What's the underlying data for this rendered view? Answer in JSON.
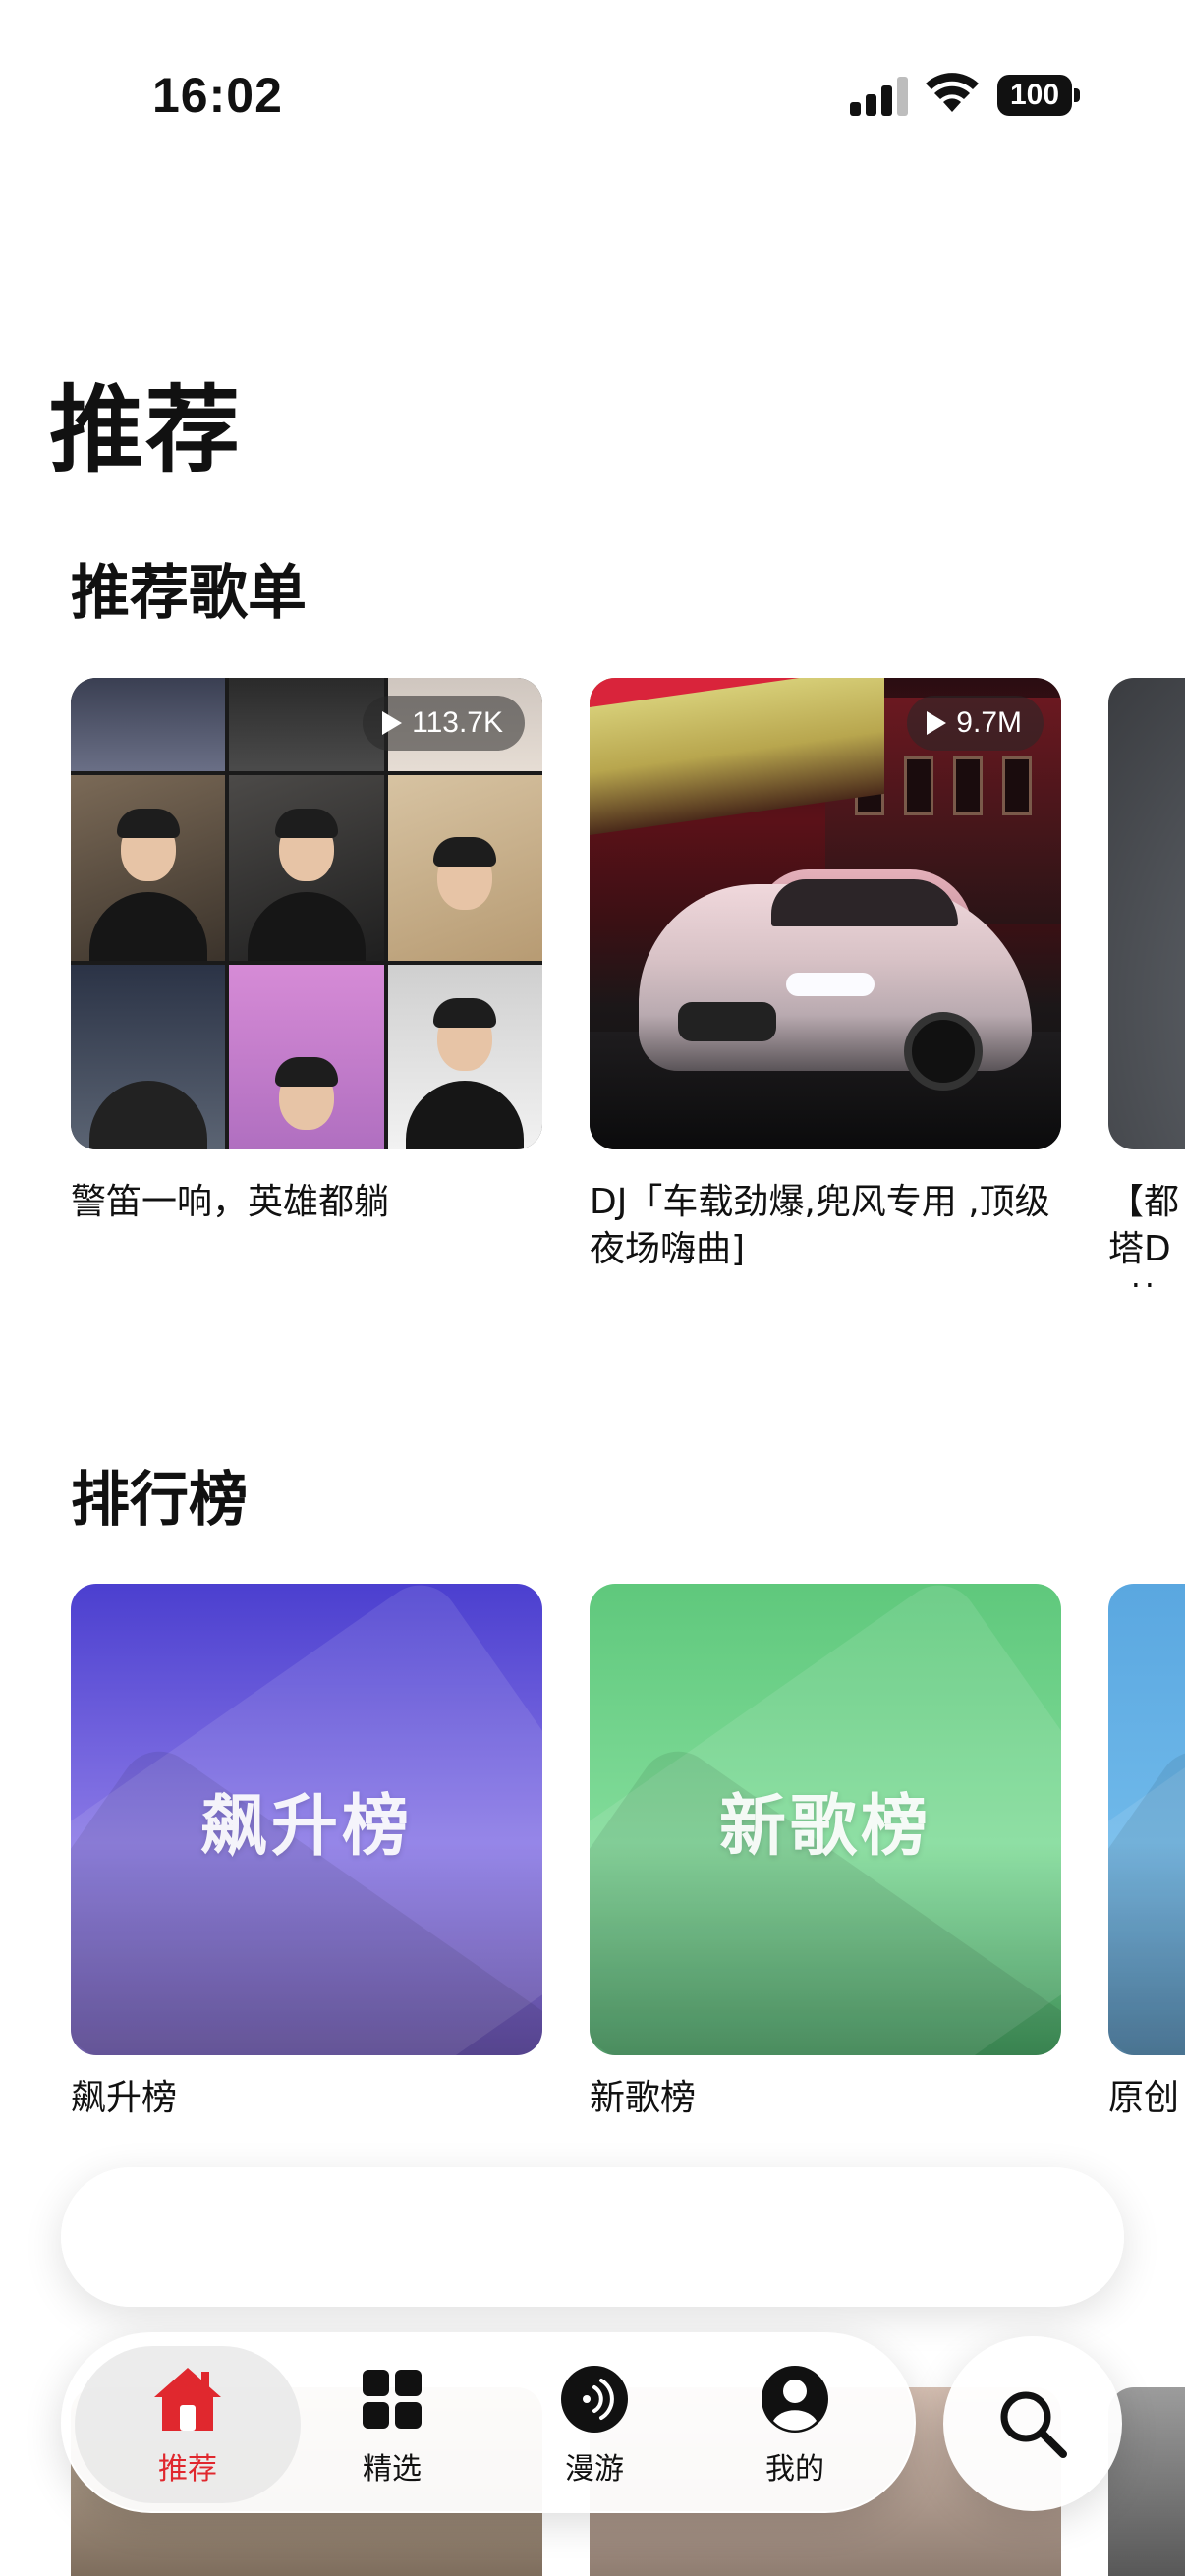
{
  "status_bar": {
    "time": "16:02",
    "battery": "100"
  },
  "page_title": "推荐",
  "playlists": {
    "title": "推荐歌单",
    "items": [
      {
        "caption": "警笛一响，英雄都躺",
        "plays": "113.7K"
      },
      {
        "caption": "DJ「车载劲爆,兜风专用 ,顶级夜场嗨曲]",
        "plays": "9.7M"
      },
      {
        "caption": "【都塔Dutt"
      }
    ]
  },
  "charts": {
    "title": "排行榜",
    "items": [
      {
        "cover_text": "飙升榜",
        "caption": "飙升榜",
        "color_top": "#4b3fcf",
        "color_bottom": "#5d4a9a"
      },
      {
        "cover_text": "新歌榜",
        "caption": "新歌榜",
        "color_top": "#5fc87c",
        "color_bottom": "#3e8e57"
      },
      {
        "cover_text": "",
        "caption": "原创",
        "color_top": "#5aa7e0",
        "color_bottom": "#3d6f93"
      }
    ]
  },
  "tab_bar": {
    "tabs": [
      {
        "label": "推荐",
        "icon": "home-icon",
        "active": true
      },
      {
        "label": "精选",
        "icon": "grid-icon",
        "active": false
      },
      {
        "label": "漫游",
        "icon": "roam-icon",
        "active": false
      },
      {
        "label": "我的",
        "icon": "profile-icon",
        "active": false
      }
    ],
    "accent": "#e0282e"
  }
}
